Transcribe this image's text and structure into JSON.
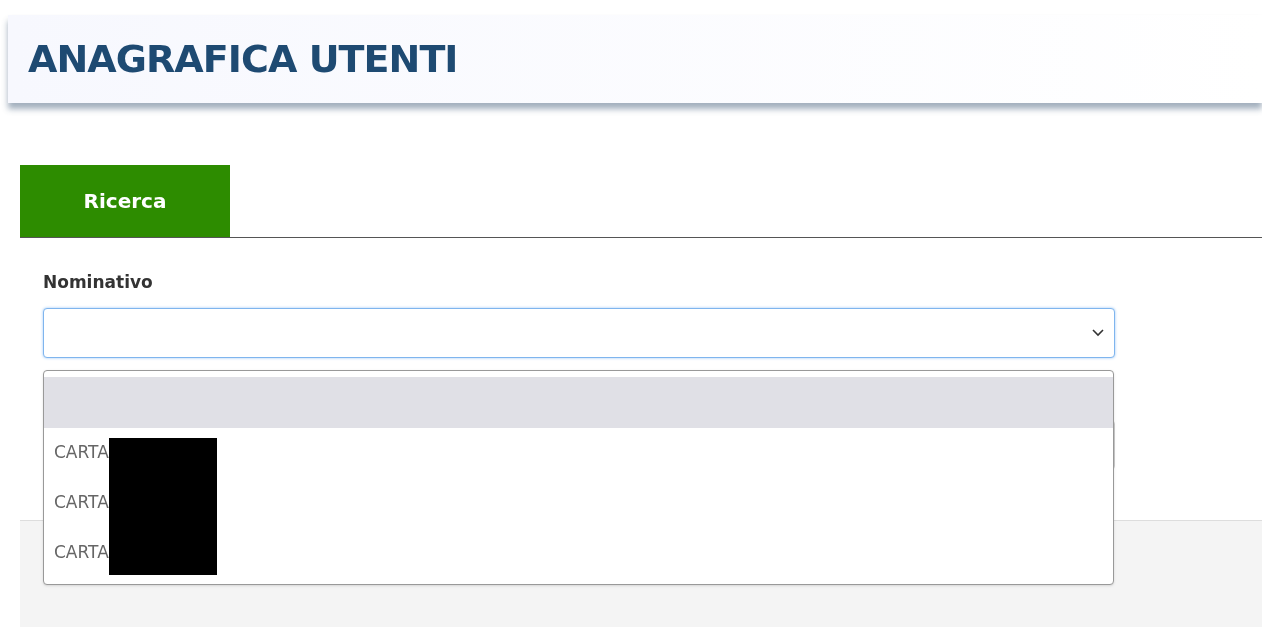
{
  "header": {
    "title": "ANAGRAFICA UTENTI"
  },
  "tabs": [
    {
      "label": "Ricerca",
      "selected": true
    }
  ],
  "form": {
    "field_label": "Nominativo",
    "dropdown": {
      "expanded": true,
      "options": [
        {
          "selected": true
        },
        {
          "label": "CARTA",
          "selected": false,
          "redacted": true
        },
        {
          "label": "CARTA",
          "selected": false,
          "redacted": true
        },
        {
          "label": "CARTA",
          "selected": false,
          "redacted": true
        }
      ]
    }
  }
}
